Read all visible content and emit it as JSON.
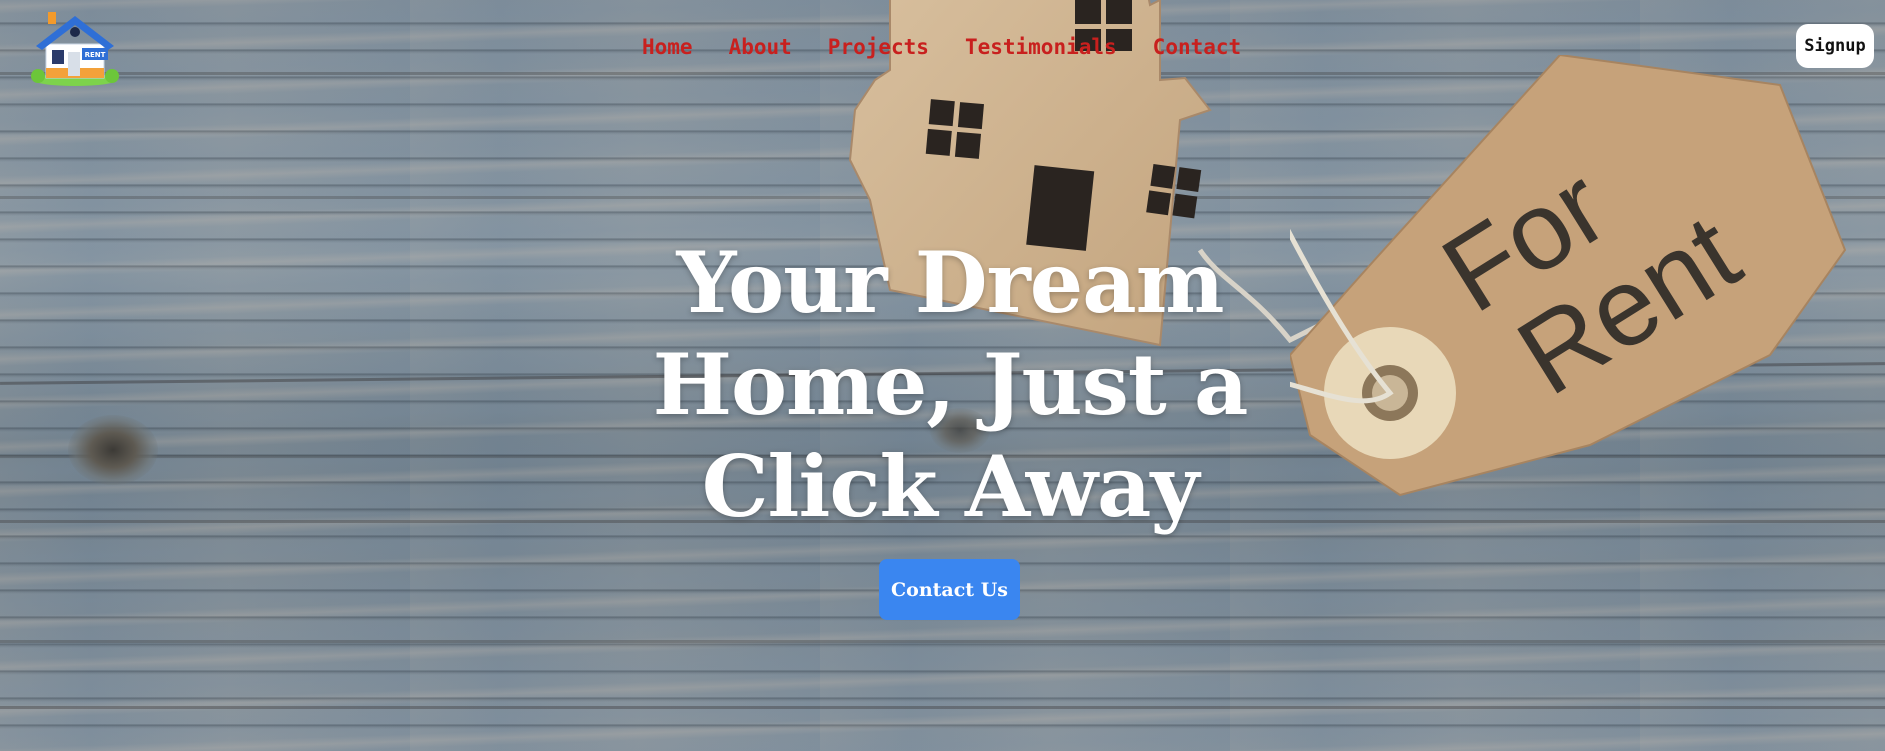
{
  "brand": {
    "logo_icon": "house-rent-icon",
    "logo_badge": "RENT"
  },
  "nav": {
    "items": [
      {
        "label": "Home"
      },
      {
        "label": "About"
      },
      {
        "label": "Projects"
      },
      {
        "label": "Testimonials"
      },
      {
        "label": "Contact"
      }
    ],
    "link_color": "#c8201e"
  },
  "header": {
    "signup_label": "Signup"
  },
  "hero": {
    "headline_line1": "Your Dream",
    "headline_line2": "Home, Just a",
    "headline_line3": "Click Away",
    "cta_label": "Contact Us",
    "cta_color": "#3a86f0",
    "tag_text_line1": "For",
    "tag_text_line2": "Rent",
    "background": "wooden-planks-image"
  }
}
